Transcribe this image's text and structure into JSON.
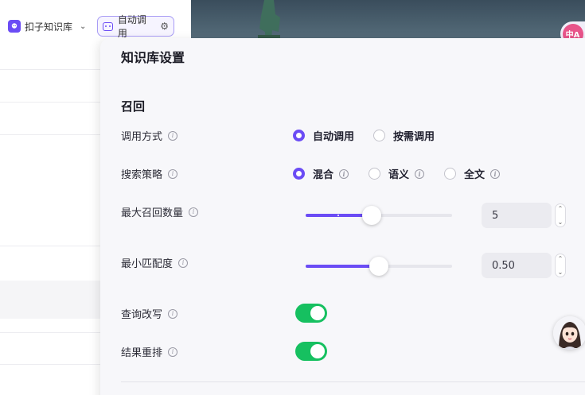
{
  "toolbar": {
    "knowledge_base_label": "扣子知识库",
    "auto_call_label": "自动调用"
  },
  "panel": {
    "title": "知识库设置",
    "section_title": "召回",
    "call_mode": {
      "label": "调用方式",
      "options": [
        "自动调用",
        "按需调用"
      ],
      "selected": "自动调用"
    },
    "search_strategy": {
      "label": "搜索策略",
      "options": [
        "混合",
        "语义",
        "全文"
      ],
      "selected": "混合"
    },
    "max_recall": {
      "label": "最大召回数量",
      "value": "5",
      "fraction": 0.45
    },
    "min_match": {
      "label": "最小匹配度",
      "value": "0.50",
      "fraction": 0.5
    },
    "query_rewrite": {
      "label": "查询改写",
      "enabled": true
    },
    "result_rerank": {
      "label": "结果重排",
      "enabled": true
    }
  },
  "translate_badge": "中A",
  "colors": {
    "accent": "#6b4cf5",
    "toggle_on": "#16c060"
  }
}
